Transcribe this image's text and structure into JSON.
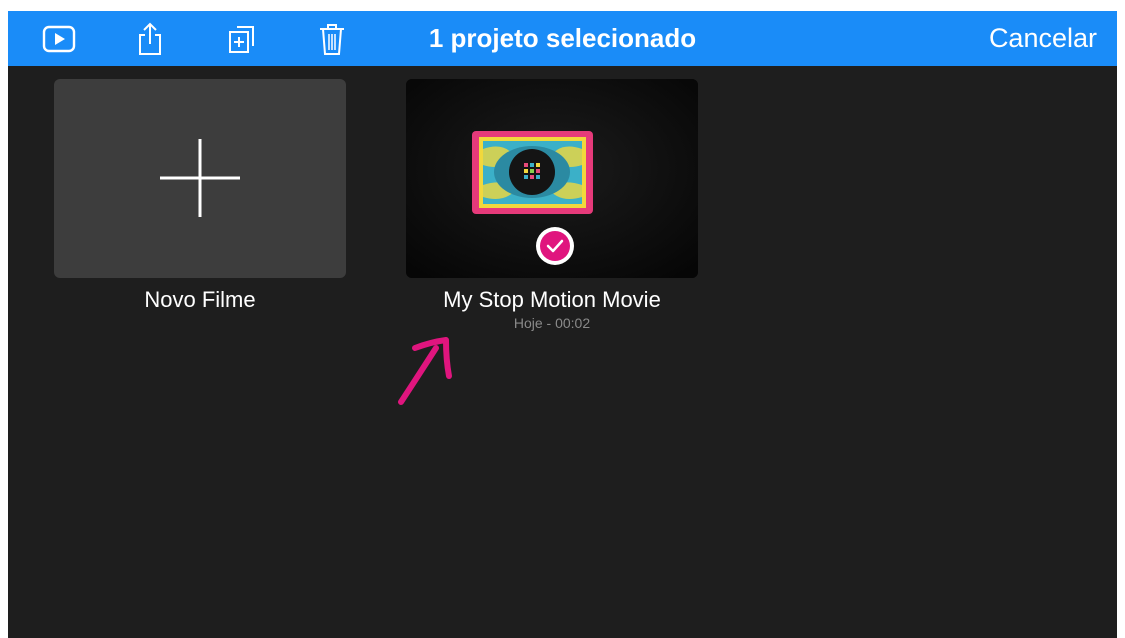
{
  "toolbar": {
    "icons": [
      "play-icon",
      "share-icon",
      "duplicate-icon",
      "trash-icon"
    ],
    "title": "1 projeto selecionado",
    "cancel_label": "Cancelar",
    "color": "#1a8cf8"
  },
  "projects": {
    "new_movie": {
      "label": "Novo Filme",
      "icon": "plus-icon"
    },
    "project": {
      "title": "My Stop Motion Movie",
      "date": "Hoje - 00:02",
      "selected": true,
      "check_color": "#e0157e"
    }
  },
  "annotation": {
    "icon": "arrow-icon",
    "color": "#e0157e"
  }
}
